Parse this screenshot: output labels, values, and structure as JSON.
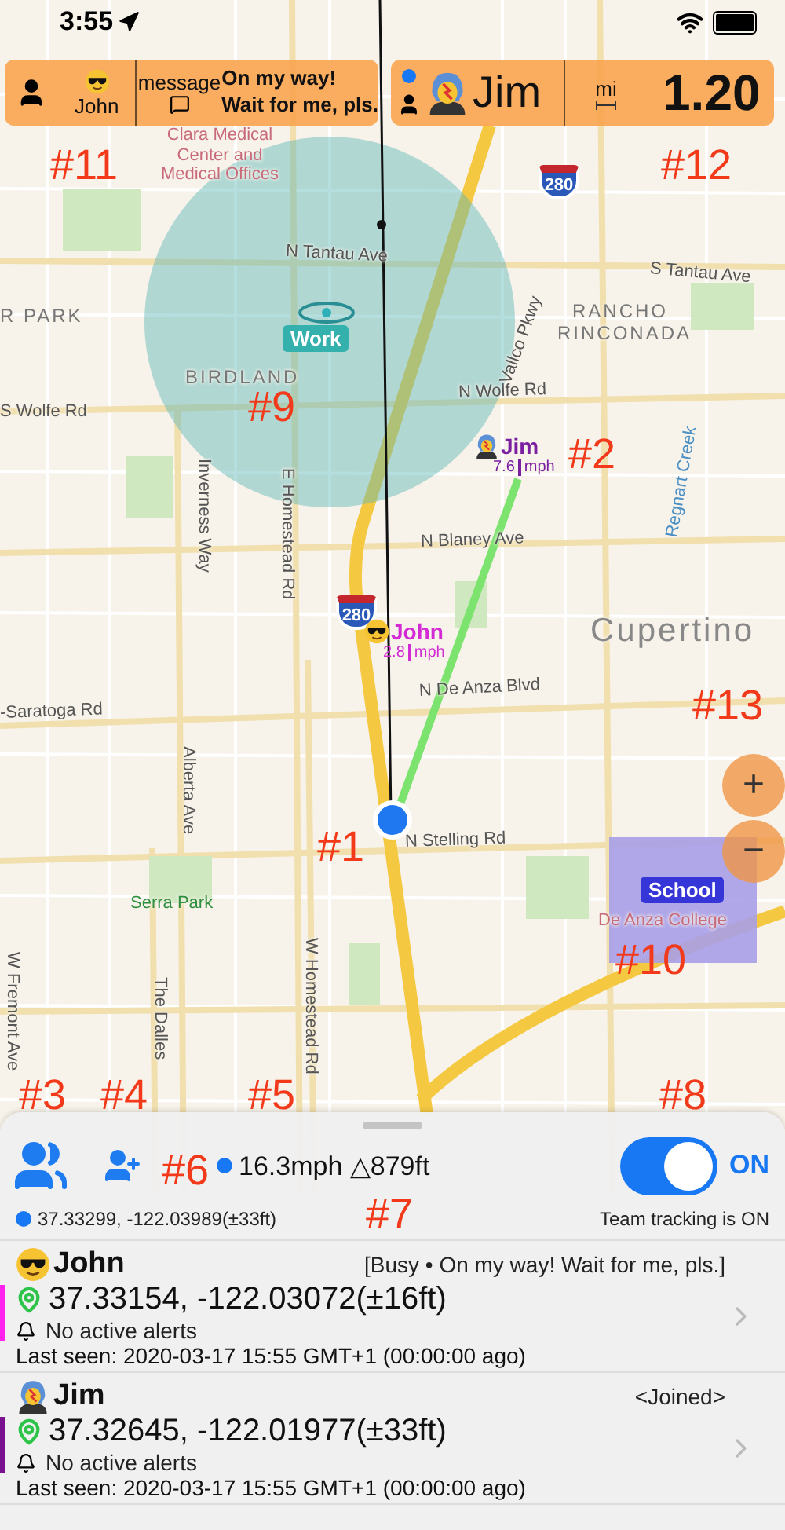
{
  "status_bar": {
    "time": "3:55"
  },
  "message_card": {
    "name": "John",
    "label": "message",
    "message_lines": [
      "On my way!",
      "Wait for me, pls."
    ]
  },
  "distance_card": {
    "name": "Jim",
    "unit": "mi",
    "value": "1.20"
  },
  "map": {
    "labels": [
      {
        "text": "Clara Medical Center and Medical Offices",
        "kind": "poi"
      },
      {
        "text": "N Tantau Ave",
        "kind": "street"
      },
      {
        "text": "S Tantau Ave",
        "kind": "street"
      },
      {
        "text": "R PARK",
        "kind": "area"
      },
      {
        "text": "Vallco Pkwy",
        "kind": "street"
      },
      {
        "text": "RANCHO RINCONADA",
        "kind": "area"
      },
      {
        "text": "BIRDLAND",
        "kind": "area"
      },
      {
        "text": "S Wolfe Rd",
        "kind": "street"
      },
      {
        "text": "N Wolfe Rd",
        "kind": "street"
      },
      {
        "text": "Regnart Creek",
        "kind": "water"
      },
      {
        "text": "Inverness Way",
        "kind": "street"
      },
      {
        "text": "E Homestead Rd",
        "kind": "street"
      },
      {
        "text": "N Blaney Ave",
        "kind": "street"
      },
      {
        "text": "Cupertino",
        "kind": "city"
      },
      {
        "text": "N De Anza Blvd",
        "kind": "street"
      },
      {
        "text": "-Saratoga Rd",
        "kind": "street"
      },
      {
        "text": "Alberta Ave",
        "kind": "street"
      },
      {
        "text": "N Stelling Rd",
        "kind": "street"
      },
      {
        "text": "Serra Park",
        "kind": "park"
      },
      {
        "text": "W Homestead Rd",
        "kind": "street"
      },
      {
        "text": "The Dalles",
        "kind": "street"
      },
      {
        "text": "W Fremont Ave",
        "kind": "street"
      },
      {
        "text": "De Anza College",
        "kind": "poi"
      }
    ],
    "highway_shields": [
      "280",
      "280"
    ],
    "geofences": [
      {
        "name": "Work",
        "kind": "circle"
      },
      {
        "name": "School",
        "kind": "rect"
      }
    ],
    "members": [
      {
        "name": "Jim",
        "speed": "7.6",
        "unit": "mph",
        "color": "#7b1fa2",
        "kind": "singer"
      },
      {
        "name": "John",
        "speed": "2.8",
        "unit": "mph",
        "color": "#d32ad6",
        "kind": "sunglasses"
      }
    ],
    "zoom_buttons": [
      "+",
      "−"
    ]
  },
  "panel": {
    "speed_altitude": "16.3mph △879ft",
    "coordinates": "37.33299, -122.03989(±33ft)",
    "tracking": {
      "on": true,
      "label": "ON",
      "caption": "Team tracking is ON"
    },
    "members": [
      {
        "name": "John",
        "kind": "sunglasses",
        "status": "[Busy • On my way! Wait for me, pls.]",
        "color": "#ff22ee",
        "coordinates": "37.33154, -122.03072(±16ft)",
        "alerts": "No active alerts",
        "last_seen": "Last seen: 2020-03-17 15:55 GMT+1 (00:00:00 ago)"
      },
      {
        "name": "Jim",
        "kind": "singer",
        "status": "<Joined>",
        "color": "#7a1190",
        "coordinates": "37.32645, -122.01977(±33ft)",
        "alerts": "No active alerts",
        "last_seen": "Last seen: 2020-03-17 15:55 GMT+1 (00:00:00 ago)"
      }
    ]
  },
  "annotations": [
    "#11",
    "#12",
    "#9",
    "#2",
    "#13",
    "#1",
    "#10",
    "#3",
    "#4",
    "#5",
    "#8",
    "#6",
    "#7"
  ]
}
